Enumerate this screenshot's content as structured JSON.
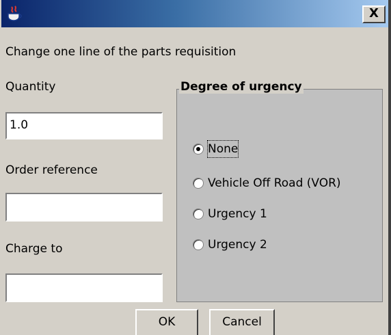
{
  "window": {
    "icon": "java-cup-icon",
    "close_label": "X"
  },
  "dialog": {
    "heading": "Change one line of the parts requisition",
    "quantity_label": "Quantity",
    "quantity_value": "1.0",
    "order_reference_label": "Order reference",
    "order_reference_value": "",
    "charge_to_label": "Charge to",
    "charge_to_value": ""
  },
  "urgency": {
    "title": "Degree of urgency",
    "selected": "None",
    "options": [
      {
        "label": "None",
        "checked": true
      },
      {
        "label": "Vehicle Off Road (VOR)",
        "checked": false
      },
      {
        "label": "Urgency 1",
        "checked": false
      },
      {
        "label": "Urgency 2",
        "checked": false
      }
    ]
  },
  "buttons": {
    "ok_label": "OK",
    "cancel_label": "Cancel"
  }
}
